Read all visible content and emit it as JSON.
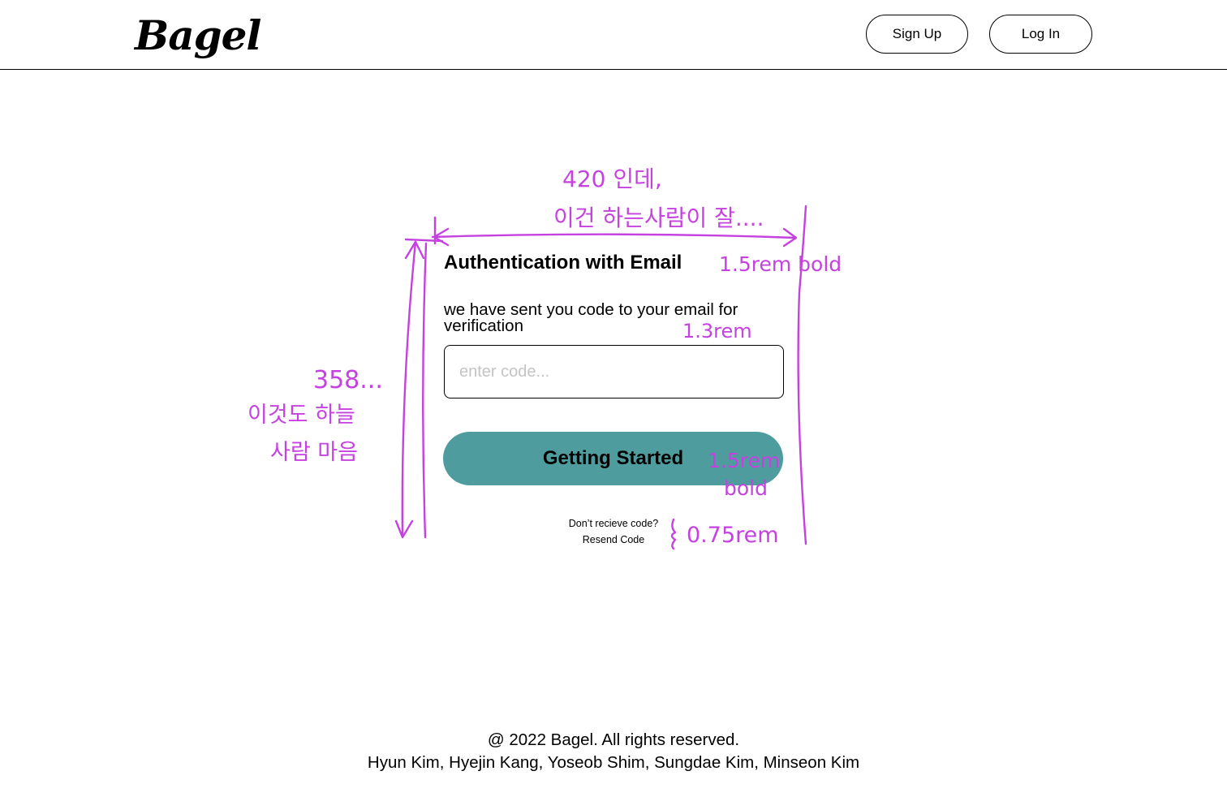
{
  "header": {
    "logo_text": "Bagel",
    "signup_label": "Sign Up",
    "login_label": "Log In"
  },
  "auth": {
    "title": "Authentication with Email",
    "subtitle": "we have sent you code to your email for verification",
    "code_placeholder": "enter code...",
    "code_value": "",
    "submit_label": "Getting Started",
    "no_code_text": "Don’t recieve code?",
    "resend_label": "Resend Code"
  },
  "footer": {
    "copyright": "@ 2022 Bagel. All rights reserved.",
    "authors": "Hyun Kim, Hyejin Kang, Yoseob Shim, Sungdae Kim, Minseon Kim"
  },
  "annotations": {
    "width_note_1": "420 인데,",
    "width_note_2": "이건 하는사람이 잘....",
    "height_note_1": "358...",
    "height_note_2": "이것도 하늘",
    "height_note_3": "사람 마음",
    "title_size": "1.5rem bold",
    "subtitle_size": "1.3rem",
    "button_size_1": "1.5rem",
    "button_size_2": "bold",
    "resend_size": "0.75rem",
    "color": "#c542e0"
  },
  "colors": {
    "cta_background": "#4f9c9f",
    "placeholder": "#c4c4c4"
  }
}
